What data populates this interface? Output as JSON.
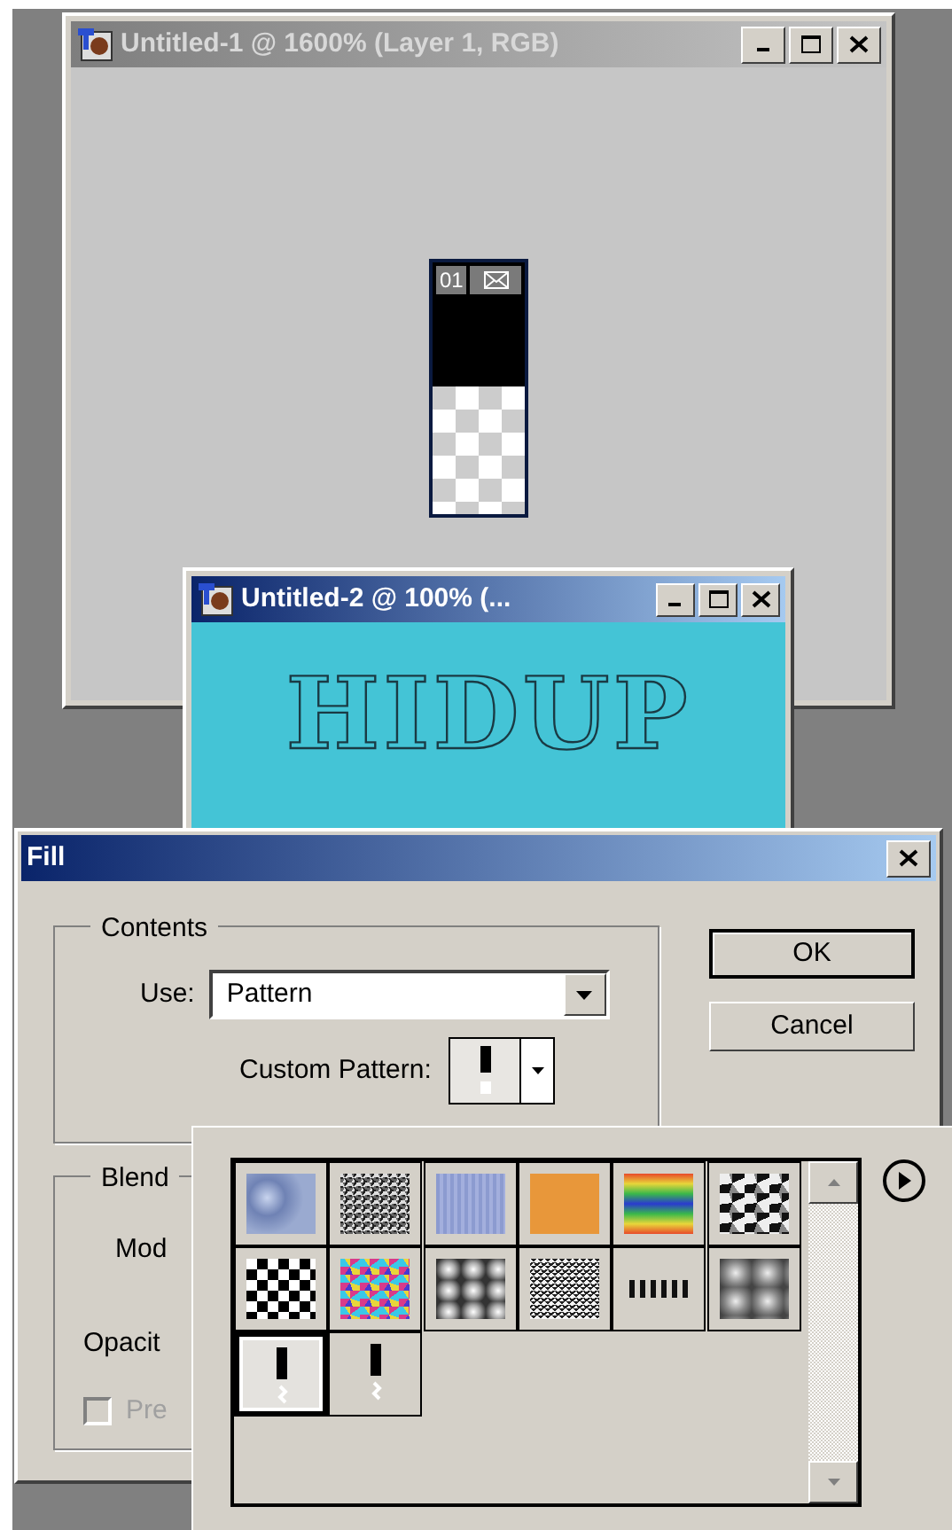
{
  "windows": [
    {
      "kind": "layer-doc",
      "title": "Untitled-1 @ 1600% (Layer 1, RGB)",
      "active": false,
      "thumbnail_label": "01"
    },
    {
      "kind": "text-doc",
      "title": "Untitled-2 @ 100% (...",
      "active": true,
      "canvas_text": "HIDUP"
    }
  ],
  "dialog": {
    "title": "Fill",
    "active": true,
    "contents": {
      "legend": "Contents",
      "use_label": "Use:",
      "use_value": "Pattern",
      "pattern_label": "Custom Pattern:",
      "picker_expanded": true
    },
    "buttons": [
      "OK",
      "Cancel"
    ],
    "blending": {
      "legend": "Blend",
      "mode_label": "Mod",
      "opacity_label": "Opacit",
      "preserve": {
        "label": "Pre",
        "checked": false,
        "disabled": true
      }
    }
  },
  "pattern_picker": {
    "patterns": [
      {
        "kind": "bubbles",
        "selected": false
      },
      {
        "kind": "noise",
        "selected": false
      },
      {
        "kind": "fine",
        "selected": false
      },
      {
        "kind": "orange",
        "selected": false
      },
      {
        "kind": "rainbow",
        "selected": false
      },
      {
        "kind": "grunge",
        "selected": false
      },
      {
        "kind": "checker",
        "selected": false
      },
      {
        "kind": "confetti",
        "selected": false
      },
      {
        "kind": "clouds",
        "selected": false
      },
      {
        "kind": "speckle",
        "selected": false
      },
      {
        "kind": "chevrons",
        "selected": false
      },
      {
        "kind": "smoke",
        "selected": false
      },
      {
        "kind": "custom",
        "selected": true
      },
      {
        "kind": "custom",
        "selected": false
      }
    ]
  }
}
